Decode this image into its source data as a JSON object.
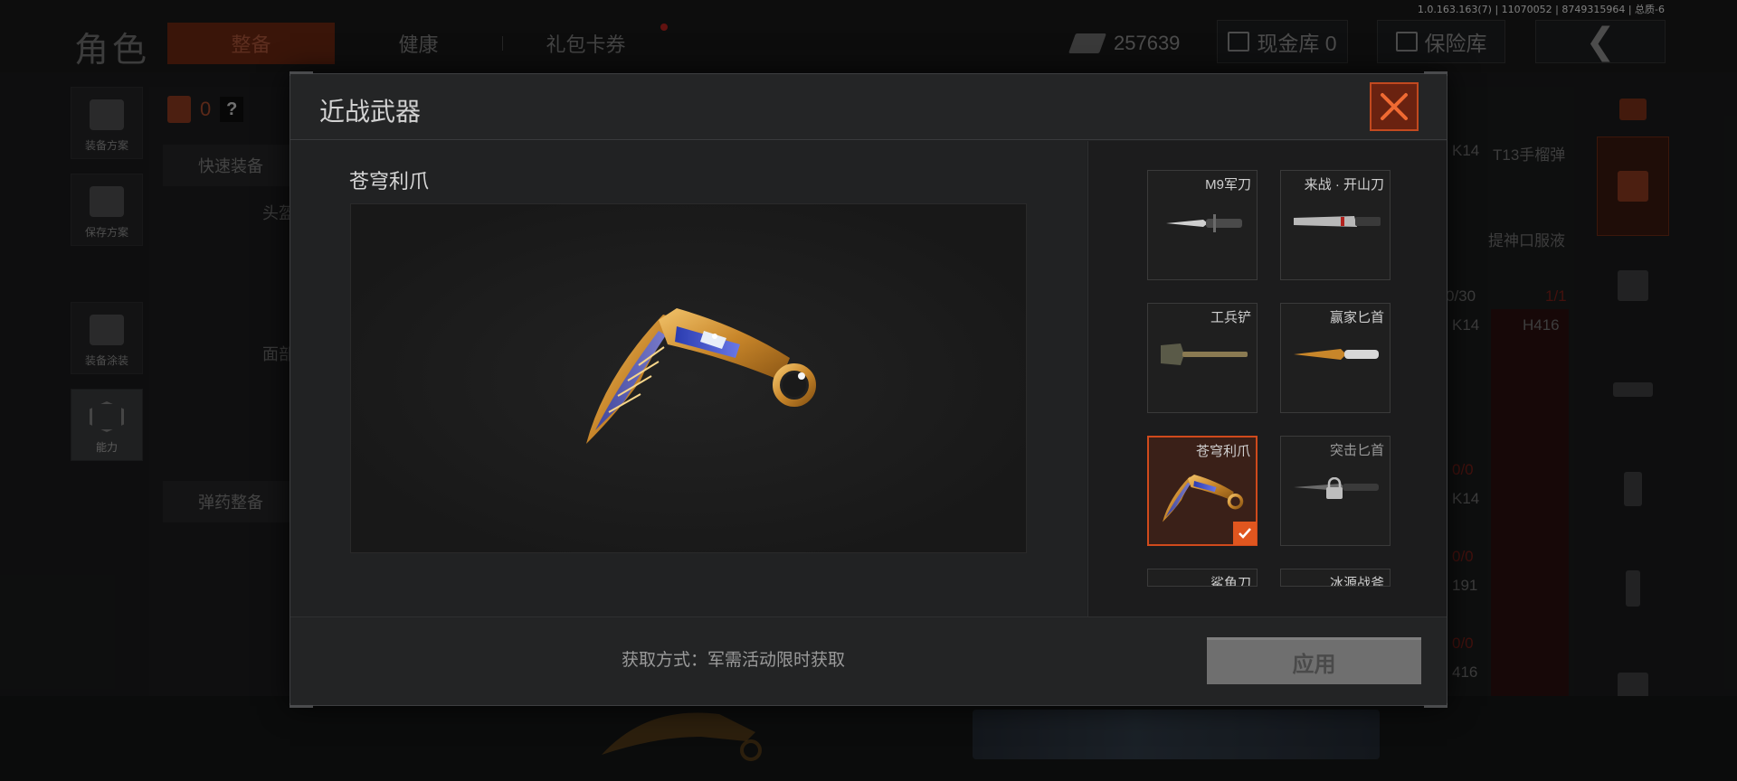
{
  "version_text": "1.0.163.163(7) | 11070052 | 8749315964 | 总质-6",
  "topbar": {
    "title": "角色",
    "tabs": [
      {
        "label": "整备",
        "active": true
      },
      {
        "label": "健康",
        "active": false
      },
      {
        "label": "礼包卡券",
        "active": false
      }
    ],
    "money": "257639",
    "cash_vault": "现金库 0",
    "safe_vault": "保险库",
    "back_icon": "chevron-left-icon"
  },
  "left_sidebar": {
    "items": [
      "装备方案",
      "保存方案",
      "装备涂装",
      "能力"
    ]
  },
  "loadout": {
    "armor_count": "0",
    "help": "?",
    "quick_equip": "快速装备",
    "slot_head": "头盔",
    "slot_face": "面部",
    "ammo_equip": "弹药整备"
  },
  "right_grid": {
    "cells": [
      "K14",
      "T13手榴弹",
      "提神口服液",
      "0/30",
      "1/1",
      "K14",
      "H416",
      "0/0",
      "K14",
      "0/0",
      "191",
      "0/0",
      "416"
    ]
  },
  "modal": {
    "title": "近战武器",
    "close_icon": "close-icon",
    "selected_name": "苍穹利爪",
    "weapons": [
      {
        "name": "M9军刀",
        "selected": false,
        "locked": false
      },
      {
        "name": "来战 · 开山刀",
        "selected": false,
        "locked": false
      },
      {
        "name": "工兵铲",
        "selected": false,
        "locked": false
      },
      {
        "name": "赢家匕首",
        "selected": false,
        "locked": false
      },
      {
        "name": "苍穹利爪",
        "selected": true,
        "locked": false
      },
      {
        "name": "突击匕首",
        "selected": false,
        "locked": true
      },
      {
        "name": "鲨鱼刀",
        "selected": false,
        "locked": false
      },
      {
        "name": "冰源战斧",
        "selected": false,
        "locked": false
      }
    ],
    "acquire_text": "获取方式：军需活动限时获取",
    "apply_label": "应用"
  },
  "colors": {
    "accent": "#e0561f",
    "close_bg": "#6a2210",
    "apply_disabled": "#6f6f6f"
  }
}
